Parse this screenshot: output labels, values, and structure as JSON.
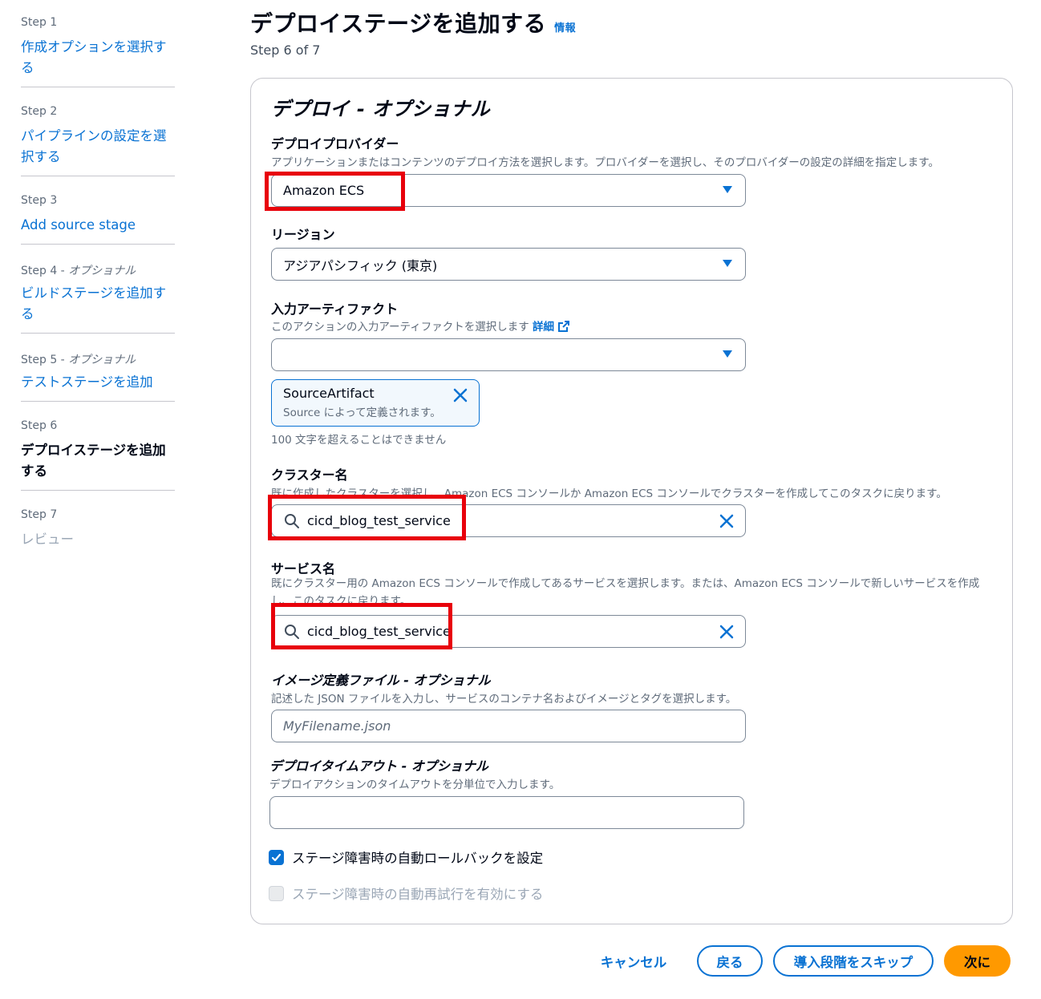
{
  "sidebar": {
    "steps": [
      {
        "label": "Step 1",
        "link": "作成オプションを選択する"
      },
      {
        "label": "Step 2",
        "link": "パイプラインの設定を選択する"
      },
      {
        "label": "Step 3",
        "link": "Add source stage"
      },
      {
        "label": "Step 4 - ",
        "label_italic": "オプショナル",
        "link": "ビルドステージを追加する"
      },
      {
        "label": "Step 5 - ",
        "label_italic": "オプショナル",
        "link": "テストステージを追加"
      },
      {
        "label": "Step 6",
        "link": "デプロイステージを追加する"
      },
      {
        "label": "Step 7",
        "link": "レビュー"
      }
    ]
  },
  "header": {
    "title": "デプロイステージを追加する",
    "info": "情報",
    "step_counter": "Step 6 of 7"
  },
  "panel": {
    "title": "デプロイ - オプショナル",
    "provider": {
      "label": "デプロイプロバイダー",
      "desc": "アプリケーションまたはコンテンツのデプロイ方法を選択します。プロバイダーを選択し、そのプロバイダーの設定の詳細を指定します。",
      "value": "Amazon ECS"
    },
    "region": {
      "label": "リージョン",
      "value": "アジアパシフィック (東京)"
    },
    "artifact": {
      "label": "入力アーティファクト",
      "desc": "このアクションの入力アーティファクトを選択します",
      "link": "詳細",
      "value": "",
      "token_name": "SourceArtifact",
      "token_desc": "Source によって定義されます。",
      "hint": "100 文字を超えることはできません"
    },
    "cluster": {
      "label": "クラスター名",
      "desc": "既に作成したクラスターを選択し、Amazon ECS コンソールか Amazon ECS コンソールでクラスターを作成してこのタスクに戻ります。",
      "value": "cicd_blog_test_service"
    },
    "service": {
      "label": "サービス名",
      "desc": "既にクラスター用の Amazon ECS コンソールで作成してあるサービスを選択します。または、Amazon ECS コンソールで新しいサービスを作成し、このタスクに戻ります。",
      "value": "cicd_blog_test_service"
    },
    "image_def": {
      "label": "イメージ定義ファイル - オプショナル",
      "desc": "記述した JSON ファイルを入力し、サービスのコンテナ名およびイメージとタグを選択します。",
      "placeholder": "MyFilename.json"
    },
    "timeout": {
      "label": "デプロイタイムアウト - オプショナル",
      "desc": "デプロイアクションのタイムアウトを分単位で入力します。",
      "value": ""
    },
    "rollback": {
      "label": "ステージ障害時の自動ロールバックを設定",
      "checked": true
    },
    "retry": {
      "label": "ステージ障害時の自動再試行を有効にする",
      "checked": false,
      "disabled": true
    }
  },
  "footer": {
    "cancel": "キャンセル",
    "back": "戻る",
    "skip": "導入段階をスキップ",
    "next": "次に"
  },
  "colors": {
    "accent": "#0972d3",
    "primary_button": "#ff9900",
    "highlight_box": "#e8000b"
  }
}
